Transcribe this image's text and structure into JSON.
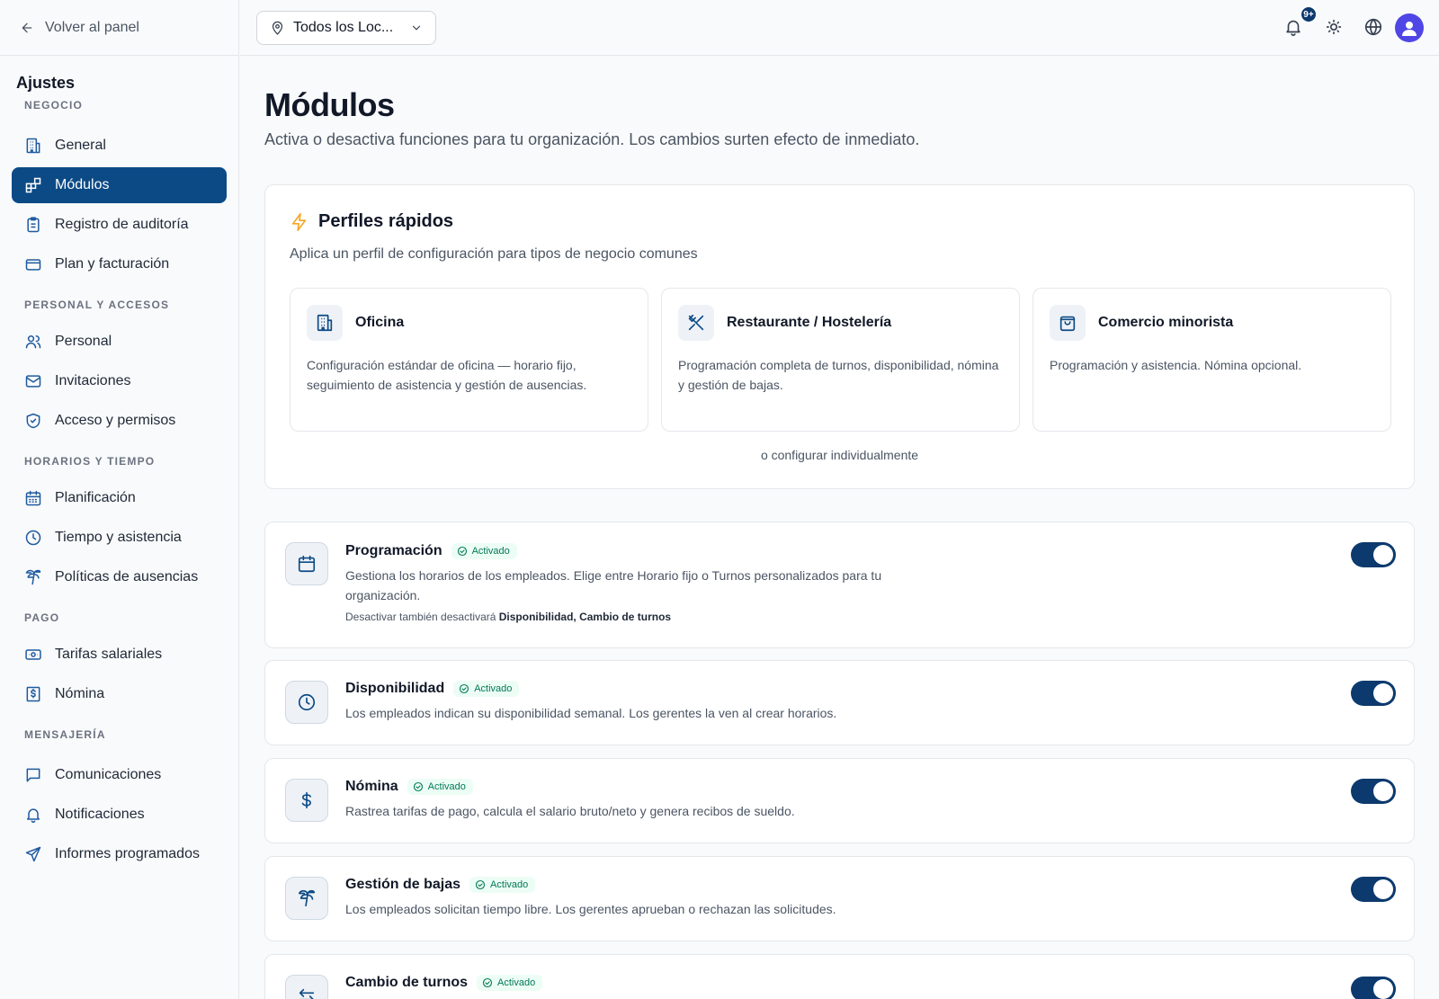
{
  "sidebar": {
    "back_label": "Volver al panel",
    "title": "Ajustes",
    "sections": {
      "business": "NEGOCIO",
      "staff": "PERSONAL Y ACCESOS",
      "schedule": "HORARIOS Y TIEMPO",
      "pay": "PAGO",
      "messaging": "MENSAJERÍA"
    },
    "items": {
      "general": "General",
      "modules": "Módulos",
      "audit": "Registro de auditoría",
      "billing": "Plan y facturación",
      "staff": "Personal",
      "invitations": "Invitaciones",
      "access": "Acceso y permisos",
      "planning": "Planificación",
      "time": "Tiempo y asistencia",
      "absence": "Políticas de ausencias",
      "rates": "Tarifas salariales",
      "payroll": "Nómina",
      "comms": "Comunicaciones",
      "notifications": "Notificaciones",
      "reports": "Informes programados"
    },
    "active_item": "modules"
  },
  "topbar": {
    "location_value": "Todos los Loc...",
    "notifications_badge": "9+"
  },
  "page": {
    "title": "Módulos",
    "subtitle": "Activa o desactiva funciones para tu organización. Los cambios surten efecto de inmediato."
  },
  "quick_profiles": {
    "title": "Perfiles rápidos",
    "subtitle": "Aplica un perfil de configuración para tipos de negocio comunes",
    "profiles": [
      {
        "name": "Oficina",
        "description": "Configuración estándar de oficina — horario fijo, seguimiento de asistencia y gestión de ausencias.",
        "icon": "building-icon"
      },
      {
        "name": "Restaurante / Hostelería",
        "description": "Programación completa de turnos, disponibilidad, nómina y gestión de bajas.",
        "icon": "utensils-icon"
      },
      {
        "name": "Comercio minorista",
        "description": "Programación y asistencia. Nómina opcional.",
        "icon": "shopping-bag-icon"
      }
    ],
    "or_configure": "o configurar individualmente"
  },
  "modules": [
    {
      "name": "Programación",
      "status": "Activado",
      "enabled": true,
      "icon": "calendar-icon",
      "description": "Gestiona los horarios de los empleados. Elige entre Horario fijo o Turnos personalizados para tu organización.",
      "note_prefix": "Desactivar también desactivará ",
      "note_bold": "Disponibilidad, Cambio de turnos"
    },
    {
      "name": "Disponibilidad",
      "status": "Activado",
      "enabled": true,
      "icon": "clock-icon",
      "description": "Los empleados indican su disponibilidad semanal. Los gerentes la ven al crear horarios."
    },
    {
      "name": "Nómina",
      "status": "Activado",
      "enabled": true,
      "icon": "dollar-icon",
      "description": "Rastrea tarifas de pago, calcula el salario bruto/neto y genera recibos de sueldo."
    },
    {
      "name": "Gestión de bajas",
      "status": "Activado",
      "enabled": true,
      "icon": "palm-tree-icon",
      "description": "Los empleados solicitan tiempo libre. Los gerentes aprueban o rechazan las solicitudes."
    },
    {
      "name": "Cambio de turnos",
      "status": "Activado",
      "enabled": true,
      "icon": "swap-icon",
      "description": ""
    }
  ],
  "colors": {
    "accent": "#0c4a85",
    "toggle_on": "#0c3a6e",
    "status_green": "#047857",
    "highlight_icon": "#f5a623"
  }
}
